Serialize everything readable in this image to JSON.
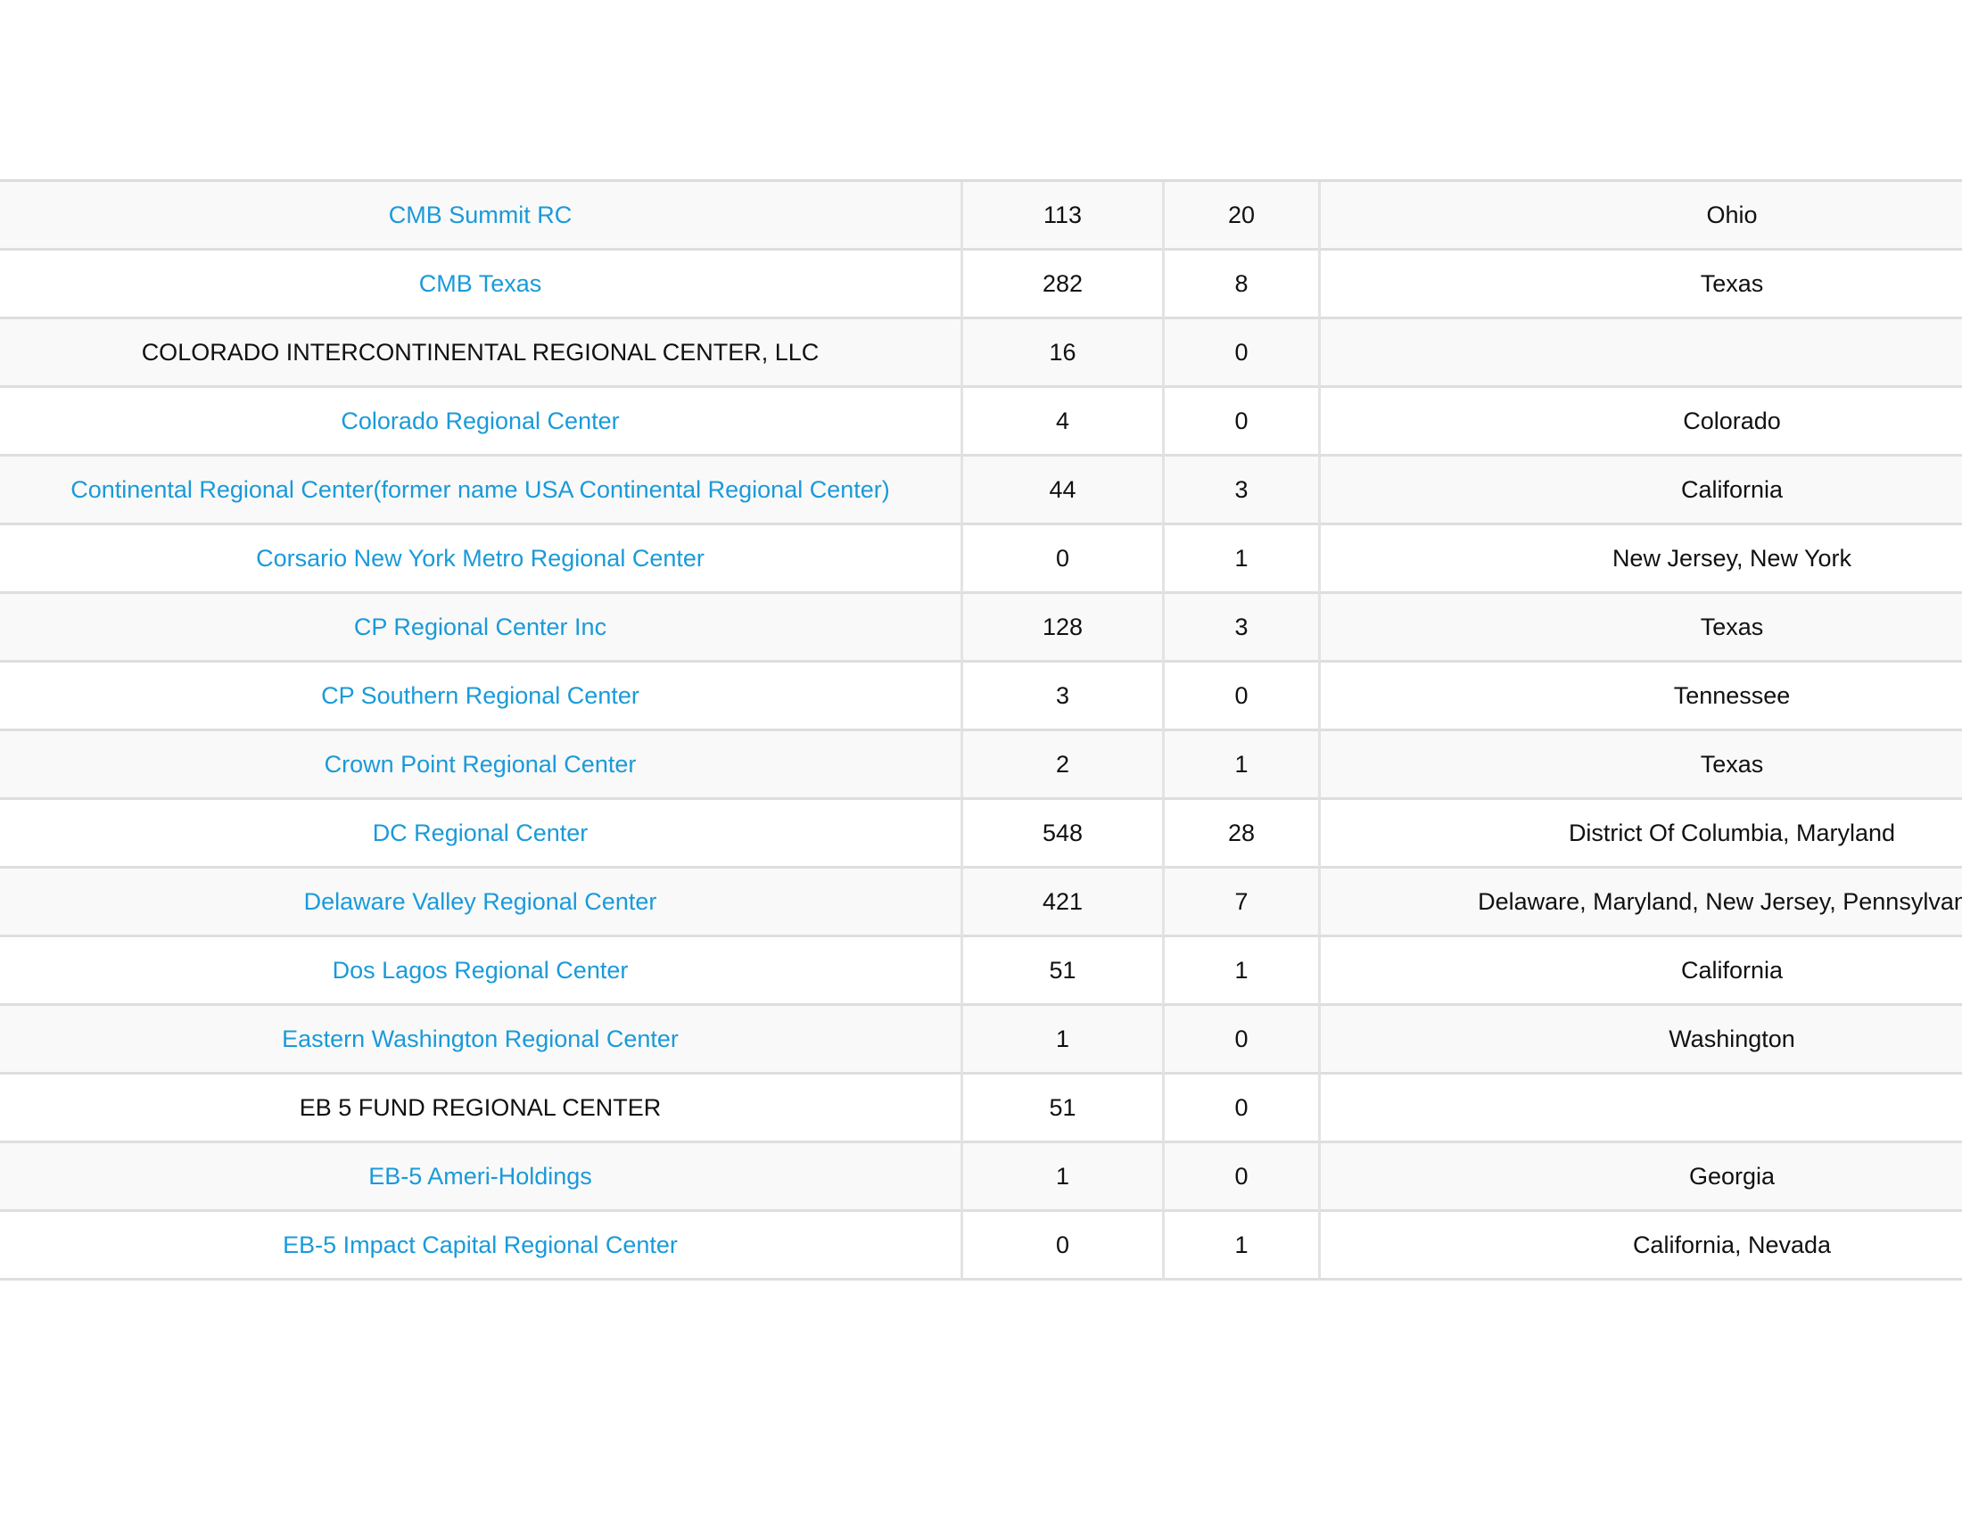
{
  "table": {
    "rows": [
      {
        "name": "CMB Summit RC",
        "linked": true,
        "col2": "113",
        "col3": "20",
        "states": "Ohio"
      },
      {
        "name": "CMB Texas",
        "linked": true,
        "col2": "282",
        "col3": "8",
        "states": "Texas"
      },
      {
        "name": "COLORADO INTERCONTINENTAL REGIONAL CENTER, LLC",
        "linked": false,
        "col2": "16",
        "col3": "0",
        "states": ""
      },
      {
        "name": "Colorado Regional Center",
        "linked": true,
        "col2": "4",
        "col3": "0",
        "states": "Colorado"
      },
      {
        "name": "Continental Regional Center(former name USA Continental Regional Center)",
        "linked": true,
        "col2": "44",
        "col3": "3",
        "states": "California"
      },
      {
        "name": "Corsario New York Metro Regional Center",
        "linked": true,
        "col2": "0",
        "col3": "1",
        "states": "New Jersey, New York"
      },
      {
        "name": "CP Regional Center Inc",
        "linked": true,
        "col2": "128",
        "col3": "3",
        "states": "Texas"
      },
      {
        "name": "CP Southern Regional Center",
        "linked": true,
        "col2": "3",
        "col3": "0",
        "states": "Tennessee"
      },
      {
        "name": "Crown Point Regional Center",
        "linked": true,
        "col2": "2",
        "col3": "1",
        "states": "Texas"
      },
      {
        "name": "DC Regional Center",
        "linked": true,
        "col2": "548",
        "col3": "28",
        "states": "District Of Columbia, Maryland"
      },
      {
        "name": "Delaware Valley Regional Center",
        "linked": true,
        "col2": "421",
        "col3": "7",
        "states": "Delaware, Maryland, New Jersey, Pennsylvania"
      },
      {
        "name": "Dos Lagos Regional Center",
        "linked": true,
        "col2": "51",
        "col3": "1",
        "states": "California"
      },
      {
        "name": "Eastern Washington Regional Center",
        "linked": true,
        "col2": "1",
        "col3": "0",
        "states": "Washington"
      },
      {
        "name": "EB 5 FUND REGIONAL CENTER",
        "linked": false,
        "col2": "51",
        "col3": "0",
        "states": ""
      },
      {
        "name": "EB-5 Ameri-Holdings",
        "linked": true,
        "col2": "1",
        "col3": "0",
        "states": "Georgia"
      },
      {
        "name": "EB-5 Impact Capital Regional Center",
        "linked": true,
        "col2": "0",
        "col3": "1",
        "states": "California, Nevada"
      }
    ]
  },
  "colors": {
    "link": "#1a9ad9",
    "text": "#111111",
    "row_stripe": "#f9f9f9",
    "border": "#dedede"
  }
}
